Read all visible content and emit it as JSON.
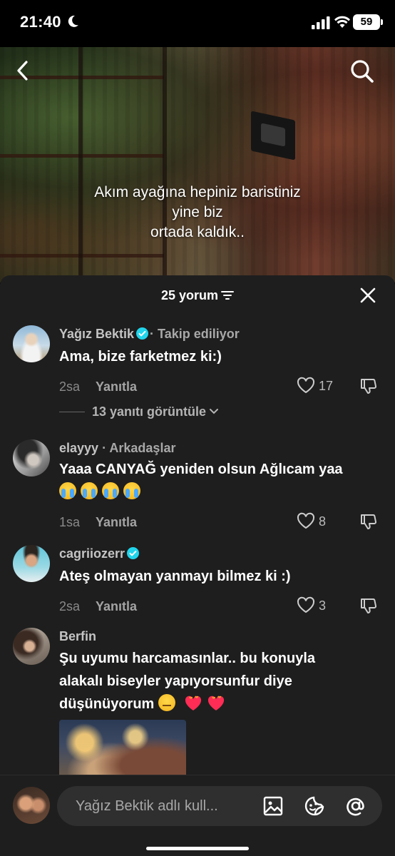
{
  "status_bar": {
    "time": "21:40",
    "battery": "59"
  },
  "video": {
    "caption_lines": [
      "Akım ayağına hepiniz baristiniz",
      "yine biz",
      "ortada kaldık.."
    ]
  },
  "sheet": {
    "title": "25 yorum"
  },
  "comments": [
    {
      "name": "Yağız Bektik",
      "verified": true,
      "relation": "· Takip ediliyor",
      "text": "Ama, bize farketmez ki:)",
      "time": "2sa",
      "reply": "Yanıtla",
      "likes": "17",
      "view_replies": "13 yanıtı görüntüle"
    },
    {
      "name": "elayyy",
      "verified": false,
      "relation": "· Arkadaşlar",
      "text": "Yaaa CANYAĞ yeniden olsun Ağlıcam yaa",
      "time": "1sa",
      "reply": "Yanıtla",
      "likes": "8"
    },
    {
      "name": "cagriiozerr",
      "verified": true,
      "relation": "",
      "text": "Ateş olmayan yanmayı bilmez ki :)",
      "time": "2sa",
      "reply": "Yanıtla",
      "likes": "3"
    },
    {
      "name": "Berfin",
      "verified": false,
      "relation": "",
      "text_lines": [
        "Şu uyumu harcamasınlar.. bu konuyla",
        "alakalı biseyler yapıyorsunfur diye",
        "düşünüyorum"
      ]
    }
  ],
  "input": {
    "placeholder": "Yağız Bektik adlı kull..."
  },
  "colors": {
    "sheet_bg": "#1e1e1e",
    "verified_blue": "#20d5ec",
    "heart_red": "#ff2d55"
  }
}
